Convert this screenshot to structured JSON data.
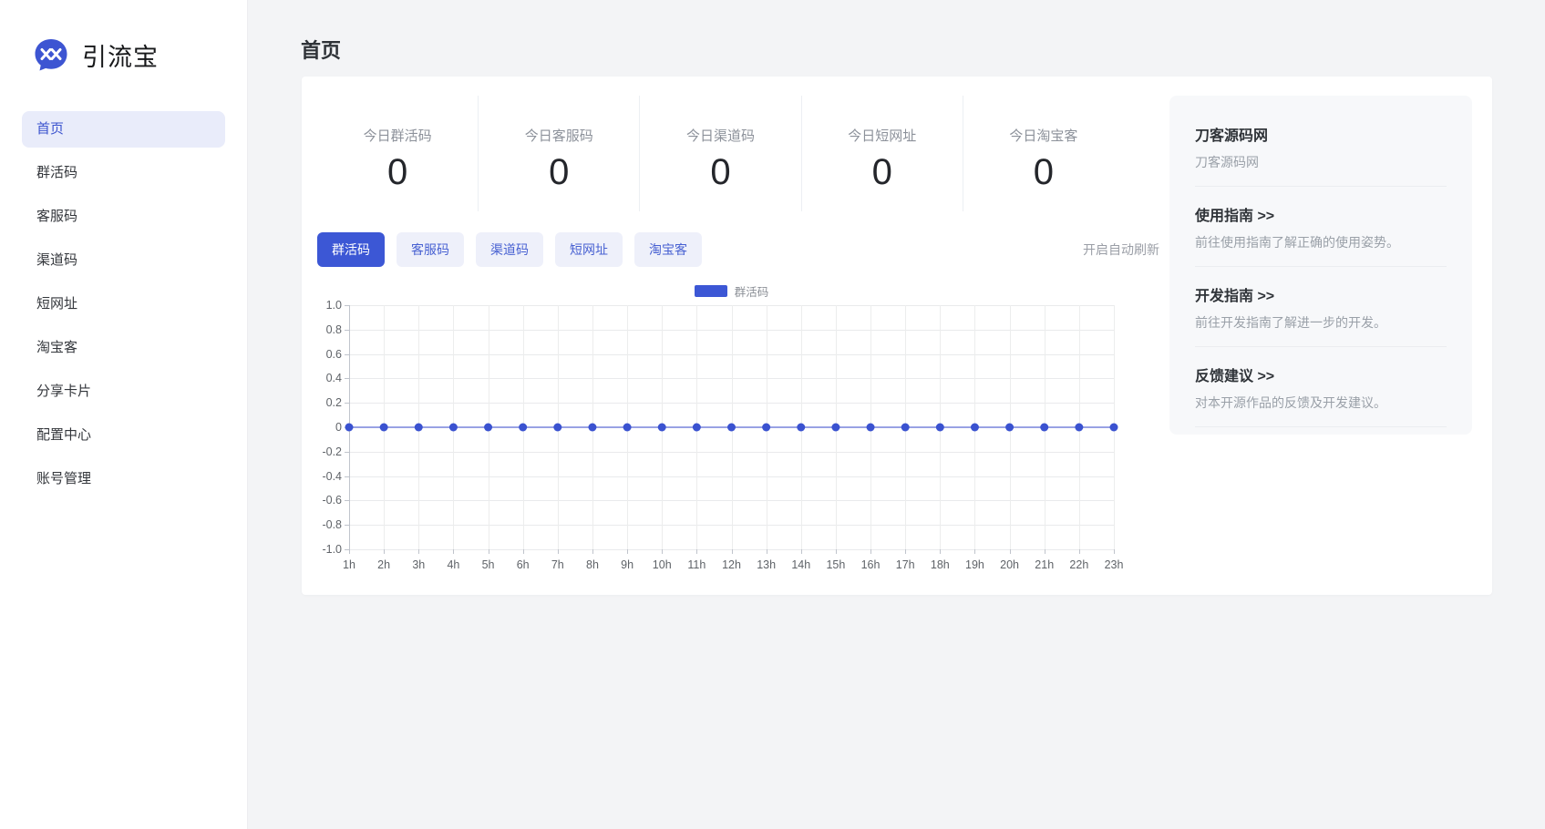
{
  "brand": {
    "name": "引流宝",
    "logo_icon": "chat-bubble-xx-icon",
    "logo_color": "#3d55d2"
  },
  "colors": {
    "accent_blue": "#3c57d5",
    "tab_inactive_bg": "#eef0fa",
    "tab_inactive_text": "#4861d2",
    "sidebar_active_bg": "#e9ecfa",
    "panel_bg": "#f7f8fa",
    "chart_line": "#7b87de",
    "chart_dot": "#3a52d0"
  },
  "header": {
    "title": "首页"
  },
  "sidebar": {
    "items": [
      {
        "label": "首页",
        "active": true
      },
      {
        "label": "群活码",
        "active": false
      },
      {
        "label": "客服码",
        "active": false
      },
      {
        "label": "渠道码",
        "active": false
      },
      {
        "label": "短网址",
        "active": false
      },
      {
        "label": "淘宝客",
        "active": false
      },
      {
        "label": "分享卡片",
        "active": false
      },
      {
        "label": "配置中心",
        "active": false
      },
      {
        "label": "账号管理",
        "active": false
      }
    ]
  },
  "stats": [
    {
      "label": "今日群活码",
      "value": "0"
    },
    {
      "label": "今日客服码",
      "value": "0"
    },
    {
      "label": "今日渠道码",
      "value": "0"
    },
    {
      "label": "今日短网址",
      "value": "0"
    },
    {
      "label": "今日淘宝客",
      "value": "0"
    }
  ],
  "tabs": [
    {
      "label": "群活码",
      "active": true
    },
    {
      "label": "客服码",
      "active": false
    },
    {
      "label": "渠道码",
      "active": false
    },
    {
      "label": "短网址",
      "active": false
    },
    {
      "label": "淘宝客",
      "active": false
    }
  ],
  "auto_refresh_label": "开启自动刷新",
  "chart_data": {
    "type": "line",
    "legend": [
      "群活码"
    ],
    "legend_position": "top-center",
    "x": [
      "1h",
      "2h",
      "3h",
      "4h",
      "5h",
      "6h",
      "7h",
      "8h",
      "9h",
      "10h",
      "11h",
      "12h",
      "13h",
      "14h",
      "15h",
      "16h",
      "17h",
      "18h",
      "19h",
      "20h",
      "21h",
      "22h",
      "23h"
    ],
    "series": [
      {
        "name": "群活码",
        "values": [
          0,
          0,
          0,
          0,
          0,
          0,
          0,
          0,
          0,
          0,
          0,
          0,
          0,
          0,
          0,
          0,
          0,
          0,
          0,
          0,
          0,
          0,
          0
        ]
      }
    ],
    "ylim": [
      -1.0,
      1.0
    ],
    "ytick_step": 0.2,
    "yticks": [
      "1.0",
      "0.8",
      "0.6",
      "0.4",
      "0.2",
      "0",
      "-0.2",
      "-0.4",
      "-0.6",
      "-0.8",
      "-1.0"
    ],
    "grid": true,
    "marker": "circle"
  },
  "info_panel": {
    "sections": [
      {
        "title": "刀客源码网",
        "desc": "刀客源码网"
      },
      {
        "title": "使用指南 >>",
        "desc": "前往使用指南了解正确的使用姿势。"
      },
      {
        "title": "开发指南 >>",
        "desc": "前往开发指南了解进一步的开发。"
      },
      {
        "title": "反馈建议 >>",
        "desc": "对本开源作品的反馈及开发建议。"
      }
    ]
  }
}
